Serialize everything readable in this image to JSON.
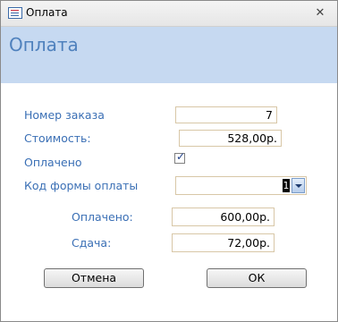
{
  "window": {
    "title": "Оплата",
    "close_glyph": "✕",
    "icon": "access-form-icon"
  },
  "header": {
    "title": "Оплата"
  },
  "form": {
    "order_number": {
      "label": "Номер заказа",
      "value": "7"
    },
    "cost": {
      "label": "Стоимость:",
      "value": "528,00р."
    },
    "paid_checkbox": {
      "label": "Оплачено",
      "checked": true,
      "glyph": "✓"
    },
    "payment_form_code": {
      "label": "Код формы оплаты",
      "value": "1"
    },
    "paid_amount": {
      "label": "Оплачено:",
      "value": "600,00р."
    },
    "change": {
      "label": "Сдача:",
      "value": "72,00р."
    }
  },
  "buttons": {
    "cancel": "Отмена",
    "ok": "ОК"
  },
  "colors": {
    "label_blue": "#3a6fb5",
    "header_band": "#c6d9f1",
    "header_text": "#4f81bd"
  }
}
